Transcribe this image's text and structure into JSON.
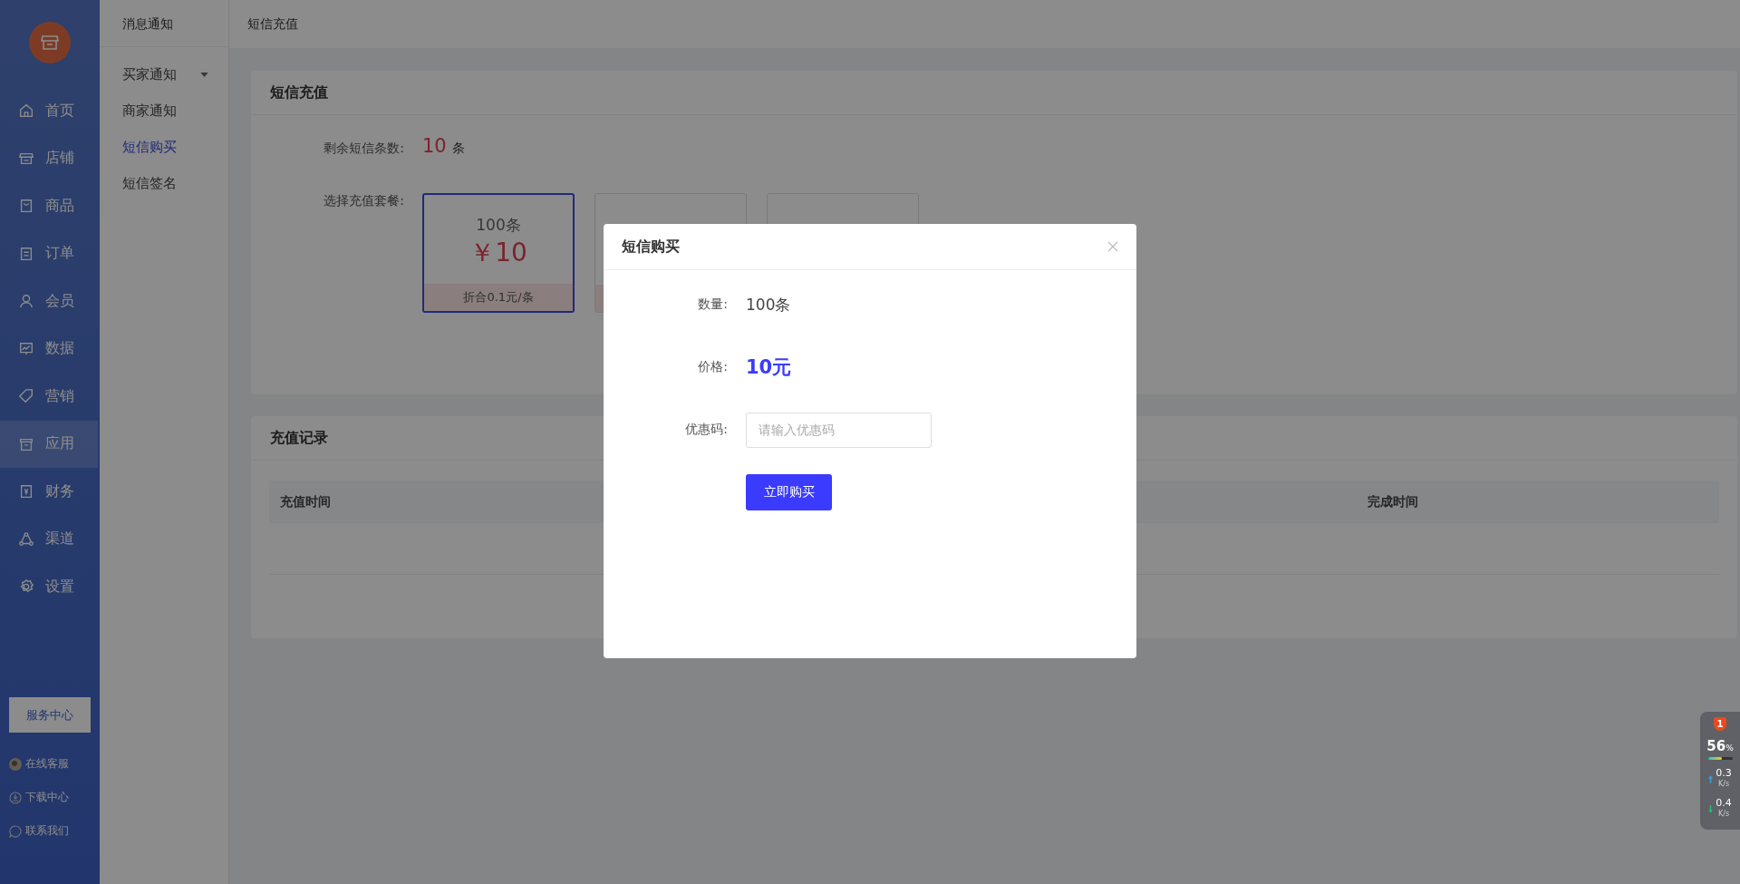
{
  "sidebar": {
    "nav": [
      {
        "label": "首页",
        "kind": "home",
        "selected": false
      },
      {
        "label": "店铺",
        "kind": "store",
        "selected": false
      },
      {
        "label": "商品",
        "kind": "goods",
        "selected": false
      },
      {
        "label": "订单",
        "kind": "order",
        "selected": false
      },
      {
        "label": "会员",
        "kind": "user",
        "selected": false
      },
      {
        "label": "数据",
        "kind": "chart",
        "selected": false
      },
      {
        "label": "营销",
        "kind": "tag",
        "selected": false
      },
      {
        "label": "应用",
        "kind": "box",
        "selected": true
      },
      {
        "label": "财务",
        "kind": "money",
        "selected": false
      },
      {
        "label": "渠道",
        "kind": "channel",
        "selected": false
      },
      {
        "label": "设置",
        "kind": "gear",
        "selected": false
      }
    ],
    "service_button": "服务中心",
    "links": [
      {
        "label": "在线客服",
        "kind": "avatar"
      },
      {
        "label": "下载中心",
        "kind": "download"
      },
      {
        "label": "联系我们",
        "kind": "chat"
      }
    ]
  },
  "submenu": {
    "title": "消息通知",
    "items": [
      {
        "label": "买家通知",
        "kind": "group",
        "selected": false
      },
      {
        "label": "商家通知",
        "kind": "link",
        "selected": false
      },
      {
        "label": "短信购买",
        "kind": "link",
        "selected": true
      },
      {
        "label": "短信签名",
        "kind": "link",
        "selected": false
      }
    ]
  },
  "page_title": "短信充值",
  "recharge": {
    "title": "短信充值",
    "remaining_label": "剩余短信条数:",
    "remaining_value": "10",
    "remaining_unit": "条",
    "package_label": "选择充值套餐:",
    "packages": [
      {
        "count": "100条",
        "price": "￥10",
        "discount": "折合0.1元/条",
        "selected": true
      },
      {
        "selected": false
      },
      {
        "selected": false
      }
    ]
  },
  "records": {
    "title": "充值记录",
    "columns": [
      "充值时间",
      "完成时间"
    ]
  },
  "dialog": {
    "title": "短信购买",
    "fields": [
      {
        "kind": "text",
        "label": "数量:",
        "value": "100条"
      },
      {
        "kind": "price",
        "label": "价格:",
        "value": "10元"
      },
      {
        "kind": "input",
        "label": "优惠码:",
        "placeholder": "请输入优惠码"
      }
    ],
    "button": "立即购买"
  },
  "monitor": {
    "badge": "1",
    "percent": "56",
    "percent_unit": "%",
    "level": 0.56,
    "upload": "0.3",
    "upload_unit": "K/s",
    "download": "0.4",
    "download_unit": "K/s"
  }
}
